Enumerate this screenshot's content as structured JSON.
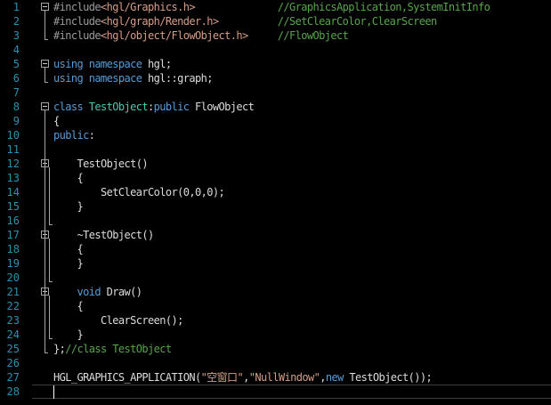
{
  "editor": {
    "lines": [
      {
        "n": "1",
        "parts": [
          [
            "pp",
            "#include"
          ],
          [
            "st",
            "<hgl/Graphics.h>"
          ],
          [
            "df",
            "              "
          ],
          [
            "cm",
            "//GraphicsApplication,SystemInitInfo"
          ]
        ]
      },
      {
        "n": "2",
        "parts": [
          [
            "pp",
            "#include"
          ],
          [
            "st",
            "<hgl/graph/Render.h>"
          ],
          [
            "df",
            "          "
          ],
          [
            "cm",
            "//SetClearColor,ClearScreen"
          ]
        ]
      },
      {
        "n": "3",
        "parts": [
          [
            "pp",
            "#include"
          ],
          [
            "st",
            "<hgl/object/FlowObject.h>"
          ],
          [
            "df",
            "     "
          ],
          [
            "cm",
            "//FlowObject"
          ]
        ]
      },
      {
        "n": "4",
        "parts": []
      },
      {
        "n": "5",
        "parts": [
          [
            "kw",
            "using"
          ],
          [
            "df",
            " "
          ],
          [
            "kw",
            "namespace"
          ],
          [
            "df",
            " hgl;"
          ]
        ]
      },
      {
        "n": "6",
        "parts": [
          [
            "kw",
            "using"
          ],
          [
            "df",
            " "
          ],
          [
            "kw",
            "namespace"
          ],
          [
            "df",
            " hgl::graph;"
          ]
        ]
      },
      {
        "n": "7",
        "parts": []
      },
      {
        "n": "8",
        "parts": [
          [
            "kw",
            "class"
          ],
          [
            "df",
            " "
          ],
          [
            "ty",
            "TestObject"
          ],
          [
            "df",
            ":"
          ],
          [
            "kw",
            "public"
          ],
          [
            "df",
            " FlowObject"
          ]
        ]
      },
      {
        "n": "9",
        "parts": [
          [
            "df",
            "{"
          ]
        ]
      },
      {
        "n": "10",
        "parts": [
          [
            "kw",
            "public"
          ],
          [
            "df",
            ":"
          ]
        ]
      },
      {
        "n": "11",
        "parts": []
      },
      {
        "n": "12",
        "parts": [
          [
            "df",
            "    TestObject()"
          ]
        ]
      },
      {
        "n": "13",
        "parts": [
          [
            "df",
            "    {"
          ]
        ]
      },
      {
        "n": "14",
        "parts": [
          [
            "df",
            "        SetClearColor(0,0,0);"
          ]
        ]
      },
      {
        "n": "15",
        "parts": [
          [
            "df",
            "    }"
          ]
        ]
      },
      {
        "n": "16",
        "parts": []
      },
      {
        "n": "17",
        "parts": [
          [
            "df",
            "    ~TestObject()"
          ]
        ]
      },
      {
        "n": "18",
        "parts": [
          [
            "df",
            "    {"
          ]
        ]
      },
      {
        "n": "19",
        "parts": [
          [
            "df",
            "    }"
          ]
        ]
      },
      {
        "n": "20",
        "parts": []
      },
      {
        "n": "21",
        "parts": [
          [
            "df",
            "    "
          ],
          [
            "kw",
            "void"
          ],
          [
            "df",
            " Draw()"
          ]
        ]
      },
      {
        "n": "22",
        "parts": [
          [
            "df",
            "    {"
          ]
        ]
      },
      {
        "n": "23",
        "parts": [
          [
            "df",
            "        ClearScreen();"
          ]
        ]
      },
      {
        "n": "24",
        "parts": [
          [
            "df",
            "    }"
          ]
        ]
      },
      {
        "n": "25",
        "parts": [
          [
            "df",
            "};"
          ],
          [
            "cm",
            "//class TestObject"
          ]
        ]
      },
      {
        "n": "26",
        "parts": []
      },
      {
        "n": "27",
        "parts": [
          [
            "df",
            "HGL_GRAPHICS_APPLICATION("
          ],
          [
            "st",
            "\"空窗口\""
          ],
          [
            "df",
            ","
          ],
          [
            "st",
            "\"NullWindow\""
          ],
          [
            "df",
            ","
          ],
          [
            "kw",
            "new"
          ],
          [
            "df",
            " TestObject());"
          ]
        ]
      },
      {
        "n": "28",
        "parts": []
      }
    ],
    "folds": [
      "1",
      "5",
      "8",
      "12",
      "17",
      "21"
    ]
  },
  "colors": {
    "background": "#000000",
    "line_number": "#2b91af",
    "keyword": "#569cd6",
    "type": "#4ec9b0",
    "comment": "#57a64a",
    "string": "#d69d85",
    "preprocessor": "#9b9b9b",
    "text": "#dcdcdc"
  }
}
